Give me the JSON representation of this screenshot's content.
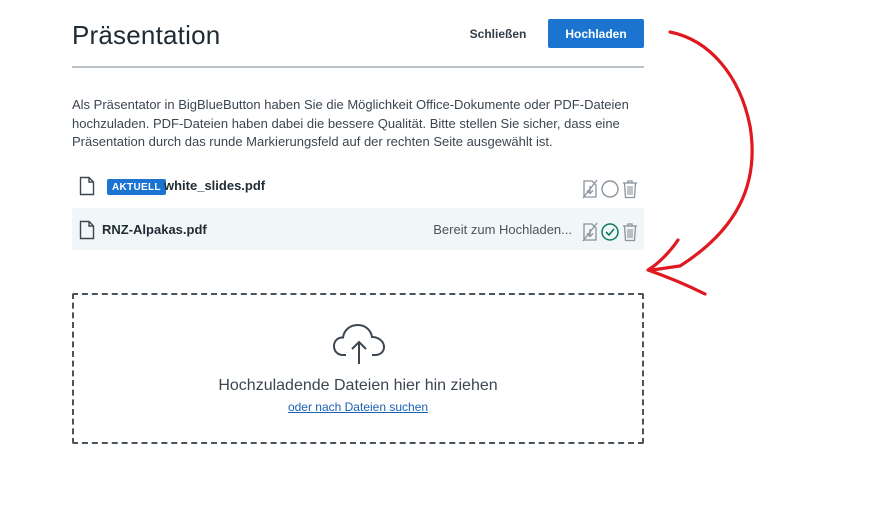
{
  "header": {
    "title": "Präsentation",
    "close_label": "Schließen",
    "upload_label": "Hochladen"
  },
  "description": "Als Präsentator in BigBlueButton haben Sie die Möglichkeit Office-Dokumente oder PDF-Dateien hochzuladen. PDF-Dateien haben dabei die bessere Qualität. Bitte stellen Sie sicher, dass eine Präsentation durch das runde Markierungsfeld auf der rechten Seite ausgewählt ist.",
  "files": [
    {
      "badge": "AKTUELL",
      "name": "white_slides.pdf",
      "status": "",
      "selected": false
    },
    {
      "badge": "",
      "name": "RNZ-Alpakas.pdf",
      "status": "Bereit zum Hochladen...",
      "selected": true
    }
  ],
  "dropzone": {
    "text": "Hochzuladende Dateien hier hin ziehen",
    "link": "oder nach Dateien suchen"
  },
  "colors": {
    "primary": "#1b75d0",
    "success": "#0f7a5c",
    "annotation": "#e0181f"
  }
}
